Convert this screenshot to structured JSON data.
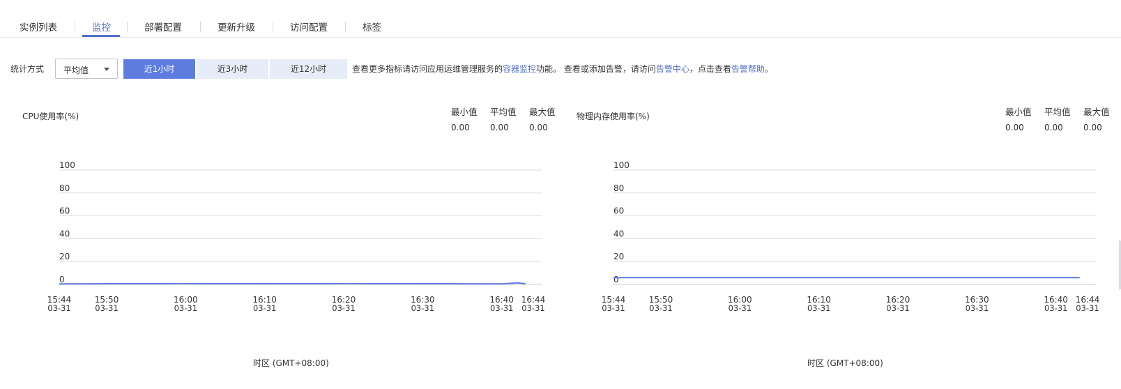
{
  "tabs": [
    {
      "label": "实例列表",
      "active": false
    },
    {
      "label": "监控",
      "active": true
    },
    {
      "label": "部署配置",
      "active": false
    },
    {
      "label": "更新升级",
      "active": false
    },
    {
      "label": "访问配置",
      "active": false
    },
    {
      "label": "标签",
      "active": false
    }
  ],
  "filter": {
    "label": "统计方式",
    "select_value": "平均值",
    "ranges": [
      {
        "label": "近1小时",
        "active": true
      },
      {
        "label": "近3小时",
        "active": false
      },
      {
        "label": "近12小时",
        "active": false
      }
    ],
    "info": {
      "text1": "查看更多指标请访问应用运维管理服务的",
      "link1": "容器监控",
      "text2": "功能。 查看或添加告警，请访问",
      "link2": "告警中心",
      "text3": "，点击查看",
      "link3": "告警帮助",
      "text4": "。"
    }
  },
  "colors": {
    "accent": "#526ecc",
    "active_button": "#5e7ce0",
    "inactive_button": "#e6ecf8",
    "series": "#5e7ce0",
    "grid": "#dddddd"
  },
  "stat_labels": {
    "min": "最小值",
    "avg": "平均值",
    "max": "最大值"
  },
  "panels": [
    {
      "title": "CPU使用率(%)",
      "stats": {
        "min": "0.00",
        "avg": "0.00",
        "max": "0.00"
      },
      "timezone": "时区 (GMT+08:00)"
    },
    {
      "title": "物理内存使用率(%)",
      "stats": {
        "min": "0.00",
        "avg": "0.00",
        "max": "0.00"
      },
      "timezone": "时区 (GMT+08:00)"
    }
  ],
  "chart_data": [
    {
      "type": "line",
      "title": "CPU使用率(%)",
      "xlabel": "时区 (GMT+08:00)",
      "ylabel": "",
      "ylim": [
        0,
        100
      ],
      "yticks": [
        0,
        20,
        40,
        60,
        80,
        100
      ],
      "xlim": [
        "15:44",
        "16:44"
      ],
      "xtick_labels": [
        {
          "time": "15:44",
          "date": "03-31"
        },
        {
          "time": "15:50",
          "date": "03-31"
        },
        {
          "time": "16:00",
          "date": "03-31"
        },
        {
          "time": "16:10",
          "date": "03-31"
        },
        {
          "time": "16:20",
          "date": "03-31"
        },
        {
          "time": "16:30",
          "date": "03-31"
        },
        {
          "time": "16:40",
          "date": "03-31"
        },
        {
          "time": "16:44",
          "date": "03-31"
        }
      ],
      "grid": true,
      "series": [
        {
          "x": [
            "15:44",
            "15:50",
            "16:00",
            "16:10",
            "16:20",
            "16:30",
            "16:40",
            "16:42",
            "16:43"
          ],
          "y": [
            0.5,
            0.6,
            0.7,
            0.6,
            0.7,
            0.6,
            0.5,
            1.4,
            0.6
          ]
        }
      ]
    },
    {
      "type": "line",
      "title": "物理内存使用率(%)",
      "xlabel": "时区 (GMT+08:00)",
      "ylabel": "",
      "ylim": [
        0,
        100
      ],
      "yticks": [
        0,
        20,
        40,
        60,
        80,
        100
      ],
      "xlim": [
        "15:44",
        "16:44"
      ],
      "xtick_labels": [
        {
          "time": "15:44",
          "date": "03-31"
        },
        {
          "time": "15:50",
          "date": "03-31"
        },
        {
          "time": "16:00",
          "date": "03-31"
        },
        {
          "time": "16:10",
          "date": "03-31"
        },
        {
          "time": "16:20",
          "date": "03-31"
        },
        {
          "time": "16:30",
          "date": "03-31"
        },
        {
          "time": "16:40",
          "date": "03-31"
        },
        {
          "time": "16:44",
          "date": "03-31"
        }
      ],
      "grid": true,
      "series": [
        {
          "x": [
            "15:44",
            "16:43"
          ],
          "y": [
            6,
            6
          ]
        }
      ]
    }
  ]
}
